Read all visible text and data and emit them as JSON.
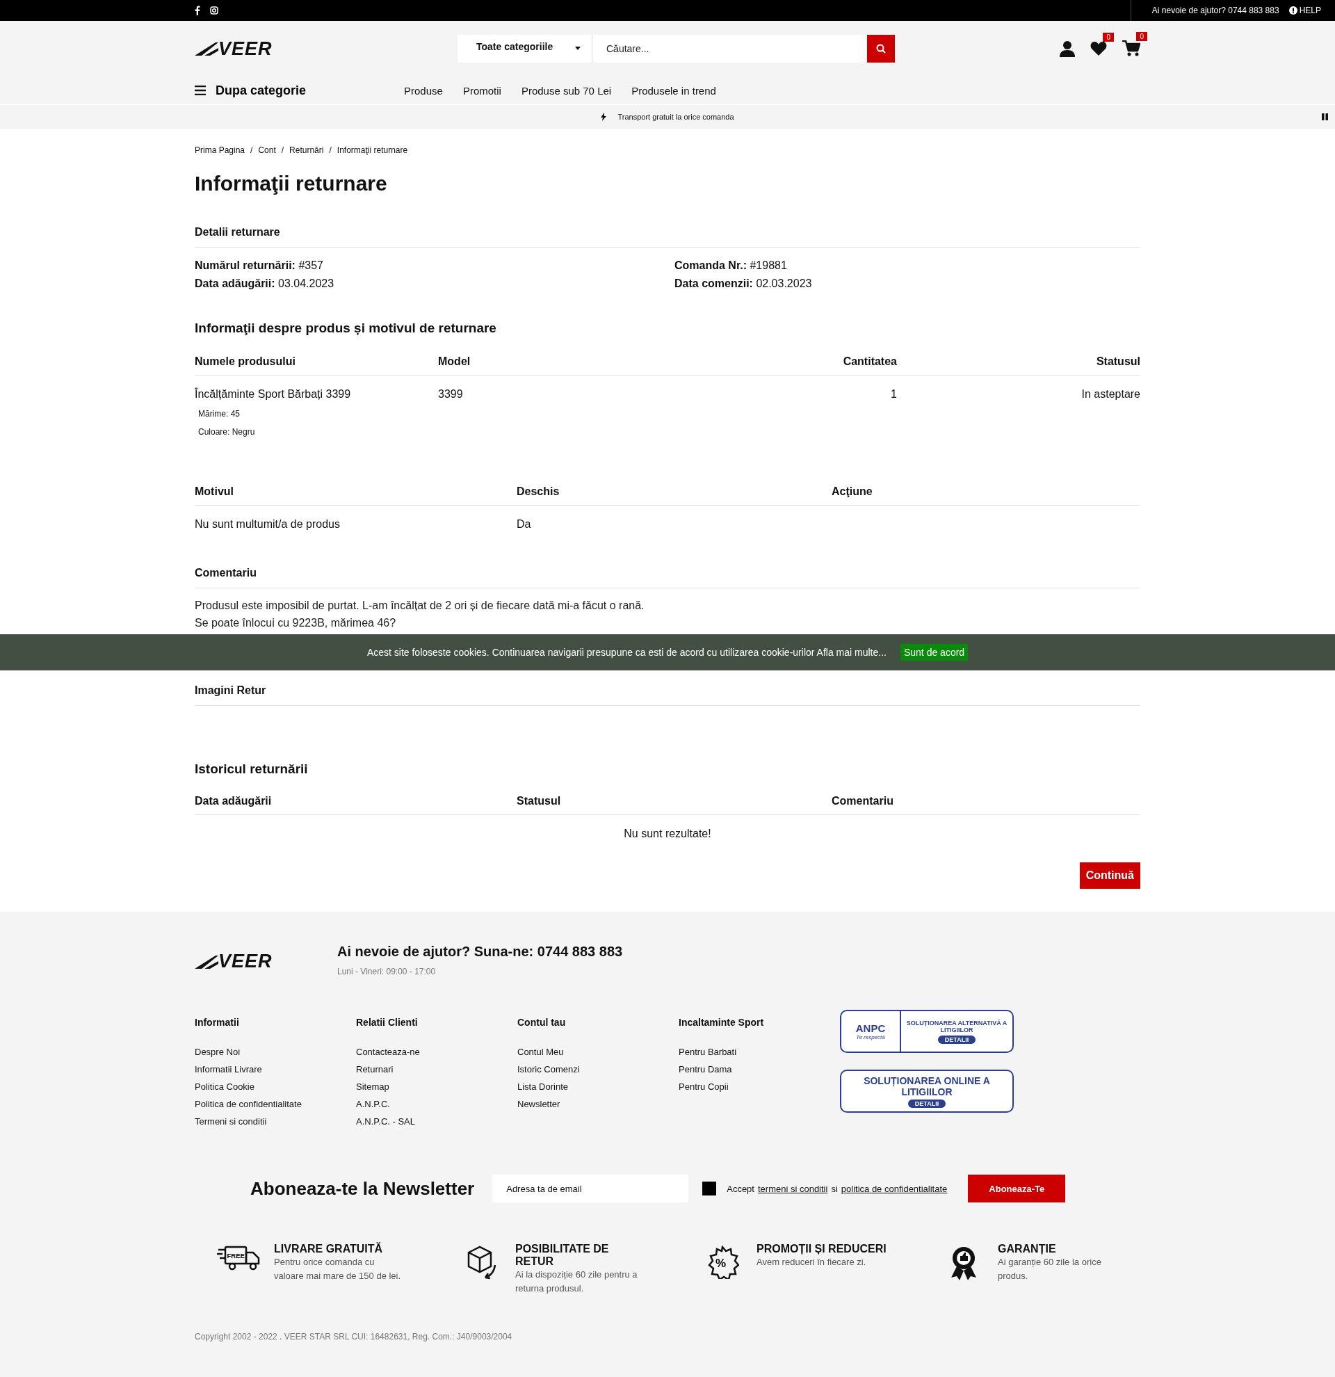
{
  "topbar": {
    "help_text": "Ai nevoie de ajutor? 0744 883 883",
    "help_link": "HELP"
  },
  "header": {
    "brand": "VEER",
    "category_select": "Toate categoriile",
    "search": {
      "placeholder": "Căutare..."
    },
    "wishlist_count": "0",
    "cart_count": "0"
  },
  "nav": {
    "category_menu": "Dupa categorie",
    "links": [
      "Produse",
      "Promotii",
      "Produse sub 70 Lei",
      "Produsele in trend"
    ]
  },
  "announcement": "Transport gratuit la orice comanda",
  "breadcrumbs": [
    "Prima Pagina",
    "Cont",
    "Returnări",
    "Informaţii returnare"
  ],
  "breadcrumb_separator": "/",
  "title": "Informaţii returnare",
  "details": {
    "heading": "Detalii returnare",
    "columns": [
      [
        {
          "label": "Numărul returnării:",
          "value": "#357"
        },
        {
          "label": "Data adăugării:",
          "value": "03.04.2023"
        }
      ],
      [
        {
          "label": "Comanda Nr.:",
          "value": "#19881"
        },
        {
          "label": "Data comenzii:",
          "value": "02.03.2023"
        }
      ]
    ]
  },
  "products": {
    "heading": "Informaţii despre produs și motivul de returnare",
    "columns": [
      "Numele produsului",
      "Model",
      "Cantitatea",
      "Statusul"
    ],
    "rows": [
      {
        "name": "Încălțăminte Sport Bărbați 3399",
        "options": [
          {
            "label": "Mărime:",
            "value": "45"
          },
          {
            "label": "Culoare:",
            "value": "Negru"
          }
        ],
        "model": "3399",
        "quantity": "1",
        "status": "In asteptare"
      }
    ]
  },
  "reason": {
    "columns": [
      "Motivul",
      "Deschis",
      "Acţiune"
    ],
    "rows": [
      {
        "reason": "Nu sunt multumit/a de produs",
        "opened": "Da"
      }
    ]
  },
  "comment": {
    "heading": "Comentariu",
    "lines": [
      "Produsul este imposibil de purtat. L-am încălțat de 2 ori și de fiecare dată mi-a făcut o rană.",
      "Se poate înlocui cu 9223B, mărimea 46?"
    ]
  },
  "images": {
    "heading": "Imagini Retur"
  },
  "history": {
    "heading": "Istoricul returnării",
    "columns": [
      "Data adăugării",
      "Statusul",
      "Comentariu"
    ],
    "empty": "Nu sunt rezultate!"
  },
  "continue_button": "Continuă",
  "cookie": {
    "text": "Acest site foloseste cookies. Continuarea navigarii presupune ca esti de acord cu utilizarea cookie-urilor",
    "link": "Afla mai multe...",
    "button": "Sunt de acord"
  },
  "footer": {
    "brand": "VEER",
    "help_heading": "Ai nevoie de ajutor? Suna-ne: 0744 883 883",
    "hours": "Luni - Vineri: 09:00 - 17:00",
    "columns": [
      {
        "heading": "Informatii",
        "links": [
          "Despre Noi",
          "Informatii Livrare",
          "Politica Cookie",
          "Politica de confidentialitate",
          "Termeni si conditii"
        ]
      },
      {
        "heading": "Relatii Clienti",
        "links": [
          "Contacteaza-ne",
          "Returnari",
          "Sitemap",
          "A.N.P.C.",
          "A.N.P.C. - SAL"
        ]
      },
      {
        "heading": "Contul tau",
        "links": [
          "Contul Meu",
          "Istoric Comenzi",
          "Lista Dorinte",
          "Newsletter"
        ]
      },
      {
        "heading": "Incaltaminte Sport",
        "links": [
          "Pentru Barbati",
          "Pentru Dama",
          "Pentru Copii"
        ]
      }
    ],
    "badges": [
      {
        "kind": "sal",
        "logo": "ANPC",
        "motto": "Te respectă",
        "title": "SOLUȚIONAREA ALTERNATIVĂ A LITIGIILOR",
        "button": "DETALII"
      },
      {
        "kind": "sol",
        "title": "SOLUȚIONAREA ONLINE A LITIGIILOR",
        "button": "DETALII"
      }
    ]
  },
  "newsletter": {
    "heading": "Aboneaza-te la Newsletter",
    "email": {
      "placeholder": "Adresa ta de email"
    },
    "consent": {
      "checked": false,
      "prefix": "Accept",
      "terms_link": "termeni si conditii",
      "joiner": "si",
      "privacy_link": "politica de confidentialitate"
    },
    "button": "Aboneaza-Te"
  },
  "features": [
    {
      "kind": "delivery",
      "icon_text": "FREE",
      "title": "LIVRARE GRATUITĂ",
      "text": "Pentru orice comanda cu valoare mai mare de 150 de lei."
    },
    {
      "kind": "return",
      "title": "POSIBILITATE DE RETUR",
      "text": "Ai la dispoziție 60 zile pentru a returna produsul."
    },
    {
      "kind": "discount",
      "icon_text": "%",
      "title": "PROMOȚII ȘI REDUCERI",
      "text": "Avem reduceri în fiecare zi."
    },
    {
      "kind": "warranty",
      "title": "GARANȚIE",
      "text": "Ai garanție 60 zile la orice produs."
    }
  ],
  "copyright": "Copyright 2002 - 2022 . VEER STAR SRL CUI: 16482631, Reg. Com.: J40/9003/2004"
}
